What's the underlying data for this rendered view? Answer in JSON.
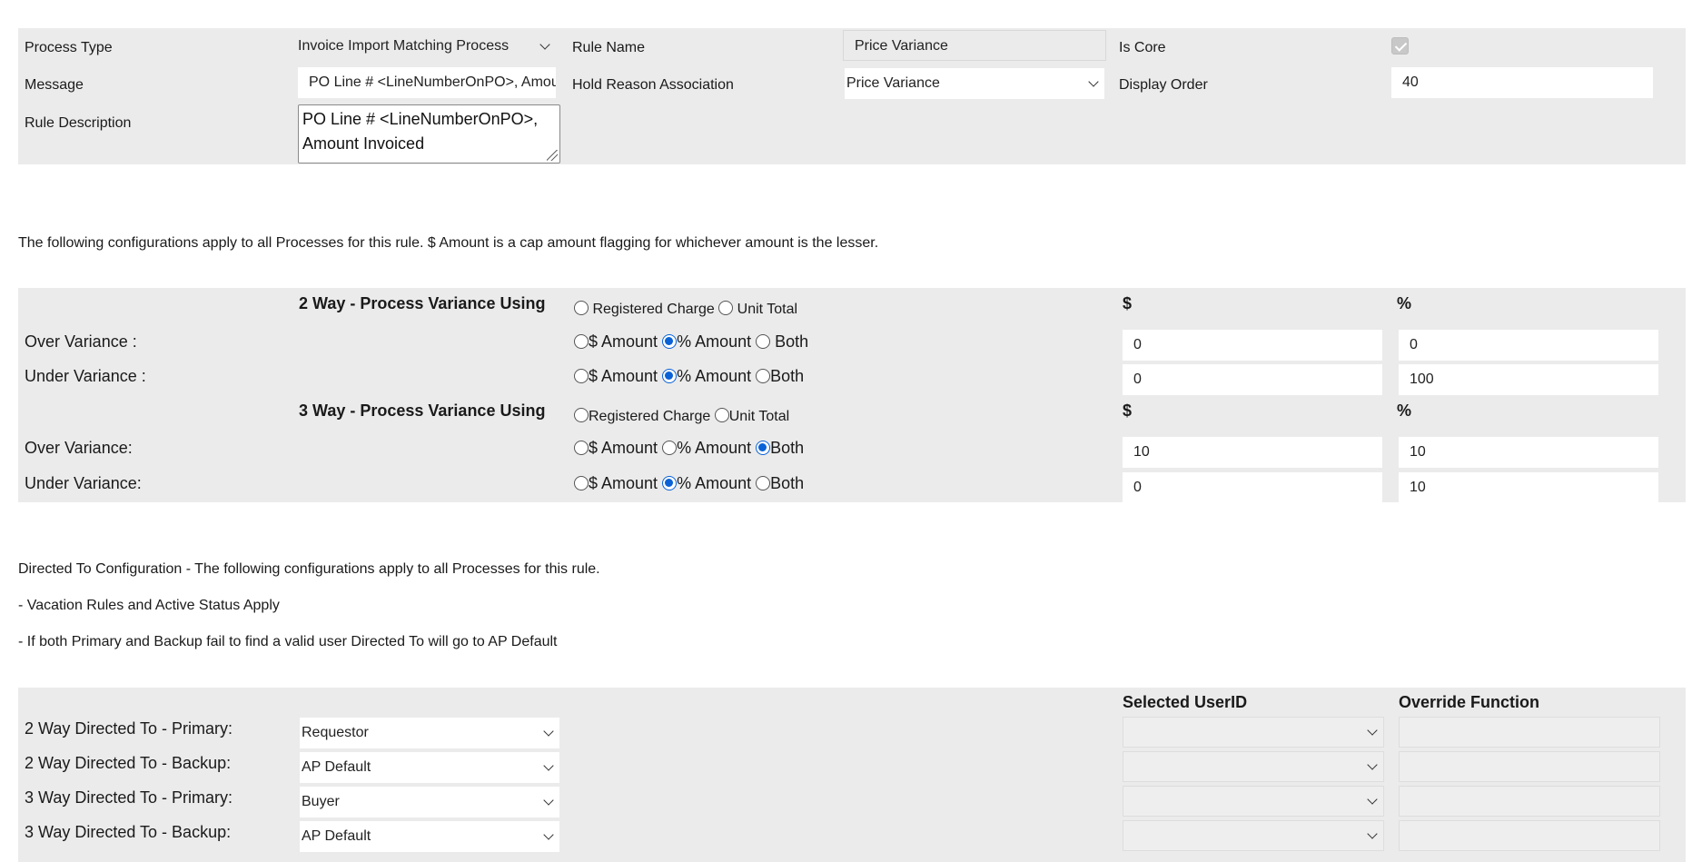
{
  "rule_form": {
    "process_type_label": "Process Type",
    "process_type_value": "Invoice Import Matching Process",
    "rule_name_label": "Rule Name",
    "rule_name_value": "Price Variance",
    "is_core_label": "Is Core",
    "is_core_checked": true,
    "message_label": "Message",
    "message_value": "PO Line # <LineNumberOnPO>, Amou",
    "hold_reason_label": "Hold Reason Association",
    "hold_reason_value": "Price Variance",
    "display_order_label": "Display Order",
    "display_order_value": "40",
    "rule_description_label": "Rule Description",
    "rule_description_line1": "PO Line # <LineNumberOnPO>,",
    "rule_description_line2": "Amount Invoiced"
  },
  "config_note": "The following configurations apply to all Processes for this rule. $ Amount is a cap amount flagging for whichever amount is the lesser.",
  "variance": {
    "dollar_header": "$",
    "percent_header": "%",
    "two_way": {
      "title": "2 Way - Process Variance Using",
      "registered_charge": "Registered Charge",
      "unit_total": "Unit Total",
      "over_label": "Over Variance :",
      "under_label": "Under Variance :",
      "over_dollar": "0",
      "over_percent": "0",
      "under_dollar": "0",
      "under_percent": "100"
    },
    "three_way": {
      "title": "3 Way - Process Variance Using",
      "registered_charge": "Registered Charge",
      "unit_total": "Unit Total",
      "over_label": "Over Variance:",
      "under_label": "Under Variance:",
      "over_dollar": "10",
      "over_percent": "10",
      "under_dollar": "0",
      "under_percent": "10"
    },
    "opt_dollar_amount": "$ Amount",
    "opt_percent_amount": "% Amount",
    "opt_both": "Both"
  },
  "directed": {
    "note1": "Directed To Configuration - The following configurations apply to all Processes for this rule.",
    "note2": "- Vacation Rules and Active Status Apply",
    "note3": "- If both Primary and Backup fail to find a valid user Directed To will go to AP Default",
    "selected_userid_header": "Selected UserID",
    "override_function_header": "Override Function",
    "rows": [
      {
        "label": "2 Way Directed To - Primary:",
        "value": "Requestor"
      },
      {
        "label": "2 Way Directed To - Backup:",
        "value": "AP Default"
      },
      {
        "label": "3 Way Directed To - Primary:",
        "value": "Buyer"
      },
      {
        "label": "3 Way Directed To - Backup:",
        "value": "AP Default"
      }
    ]
  },
  "colors": {
    "panel_bg": "#ebebeb",
    "radio_accent": "#0a62d6"
  }
}
